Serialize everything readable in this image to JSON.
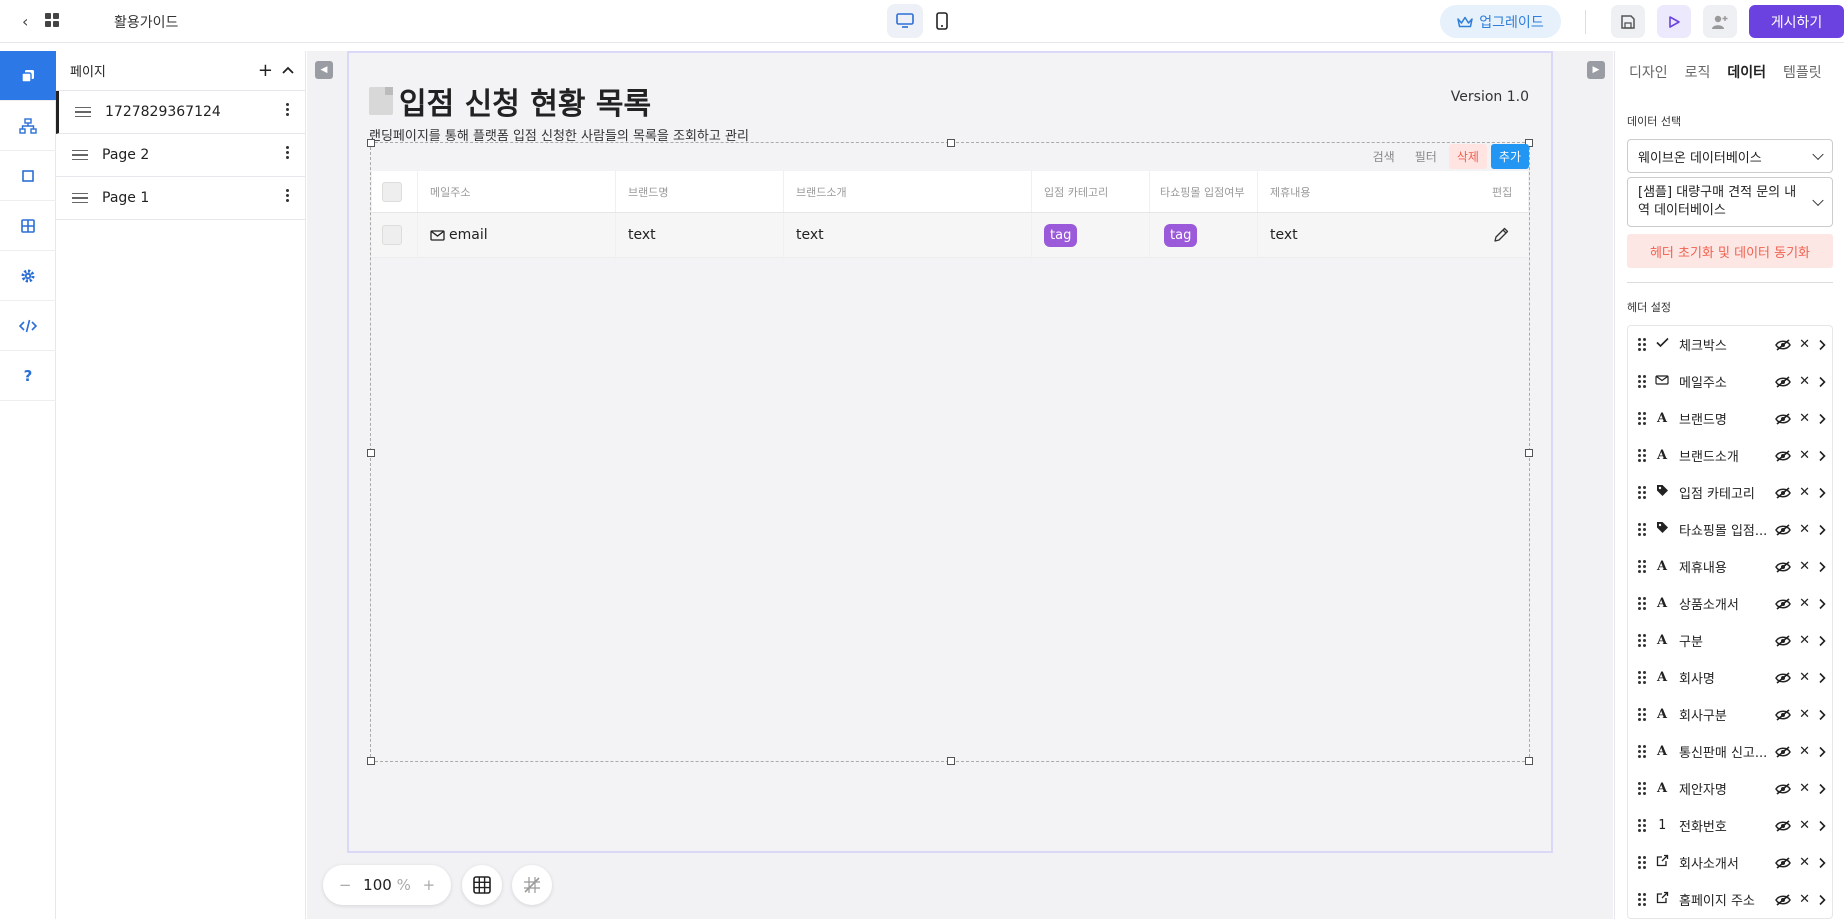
{
  "topbar": {
    "guide_label": "활용가이드",
    "upgrade_label": "업그레이드",
    "publish_label": "게시하기"
  },
  "pages_panel": {
    "title": "페이지",
    "items": [
      {
        "label": "1727829367124",
        "active": true
      },
      {
        "label": "Page 2",
        "active": false
      },
      {
        "label": "Page 1",
        "active": false
      }
    ]
  },
  "artboard": {
    "title": "입점 신청 현황 목록",
    "version": "Version 1.0",
    "subtitle": "랜딩페이지를 통해 플랫폼 입점 신청한 사람들의 목록을 조회하고 관리",
    "actions": {
      "search": "검색",
      "filter": "필터",
      "delete": "삭제",
      "add": "추가"
    },
    "table": {
      "headers": [
        "메일주소",
        "브랜드명",
        "브랜드소개",
        "입점 카테고리",
        "타쇼핑몰 입점여부",
        "제휴내용",
        "편집"
      ],
      "row": {
        "email": "email",
        "brand": "text",
        "brand_intro": "text",
        "category": "tag",
        "other_mall": "tag",
        "partnership": "text"
      }
    }
  },
  "zoom": {
    "value": "100",
    "unit": "%"
  },
  "right_panel": {
    "tabs": [
      "디자인",
      "로직",
      "데이터",
      "템플릿"
    ],
    "active_tab": "데이터",
    "data_select_label": "데이터 선택",
    "db_select": "웨이브온 데이터베이스",
    "db_table_select": "[샘플] 대량구매 견적 문의 내역 데이터베이스",
    "sync_button": "헤더 초기화 및 데이터 동기화",
    "header_settings_label": "헤더 설정",
    "headers": [
      {
        "label": "체크박스",
        "icon": "check-icon"
      },
      {
        "label": "메일주소",
        "icon": "mail-icon"
      },
      {
        "label": "브랜드명",
        "icon": "text-icon"
      },
      {
        "label": "브랜드소개",
        "icon": "text-icon"
      },
      {
        "label": "입점 카테고리",
        "icon": "tag-icon"
      },
      {
        "label": "타쇼핑몰 입점...",
        "icon": "tag-icon"
      },
      {
        "label": "제휴내용",
        "icon": "text-icon"
      },
      {
        "label": "상품소개서",
        "icon": "text-icon"
      },
      {
        "label": "구분",
        "icon": "text-icon"
      },
      {
        "label": "회사명",
        "icon": "text-icon"
      },
      {
        "label": "회사구분",
        "icon": "text-icon"
      },
      {
        "label": "통신판매 신고...",
        "icon": "text-icon"
      },
      {
        "label": "제안자명",
        "icon": "text-icon"
      },
      {
        "label": "전화번호",
        "icon": "number-icon"
      },
      {
        "label": "회사소개서",
        "icon": "link-icon"
      },
      {
        "label": "홈페이지 주소",
        "icon": "link-icon"
      }
    ]
  }
}
